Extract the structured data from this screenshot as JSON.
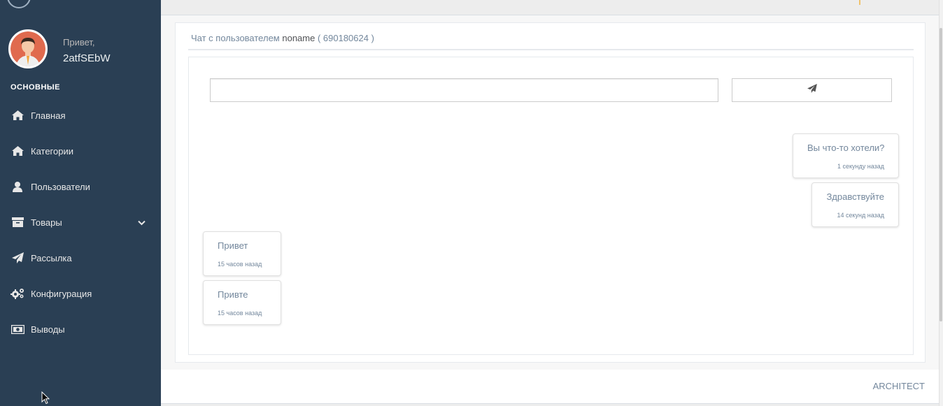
{
  "sidebar": {
    "greeting": "Привет,",
    "username": "2atfSEbW",
    "section_title": "ОСНОВНЫЕ",
    "items": [
      {
        "label": "Главная",
        "icon": "home-icon"
      },
      {
        "label": "Категории",
        "icon": "home-icon"
      },
      {
        "label": "Пользователи",
        "icon": "user-icon"
      },
      {
        "label": "Товары",
        "icon": "archive-icon"
      },
      {
        "label": "Рассылка",
        "icon": "paper-plane-icon"
      },
      {
        "label": "Конфигурация",
        "icon": "gears-icon"
      },
      {
        "label": "Выводы",
        "icon": "money-icon"
      }
    ]
  },
  "panel": {
    "title_prefix": "Чат с пользователем ",
    "title_user": "noname",
    "title_suffix": " ( 690180624 )"
  },
  "chat": {
    "input_value": "",
    "send_icon": "paper-plane-icon",
    "messages": [
      {
        "text": "Вы что-то хотели?",
        "time": "1 секунду назад",
        "side": "right"
      },
      {
        "text": "Здравствуйте",
        "time": "14 секунд назад",
        "side": "right"
      },
      {
        "text": "Привет",
        "time": "15 часов назад",
        "side": "left"
      },
      {
        "text": "Привте",
        "time": "15 часов назад",
        "side": "left"
      }
    ]
  },
  "footer": {
    "text": "ARCHITECT"
  },
  "colors": {
    "sidebar_bg": "#2a3f54",
    "text_muted": "#73879c"
  }
}
